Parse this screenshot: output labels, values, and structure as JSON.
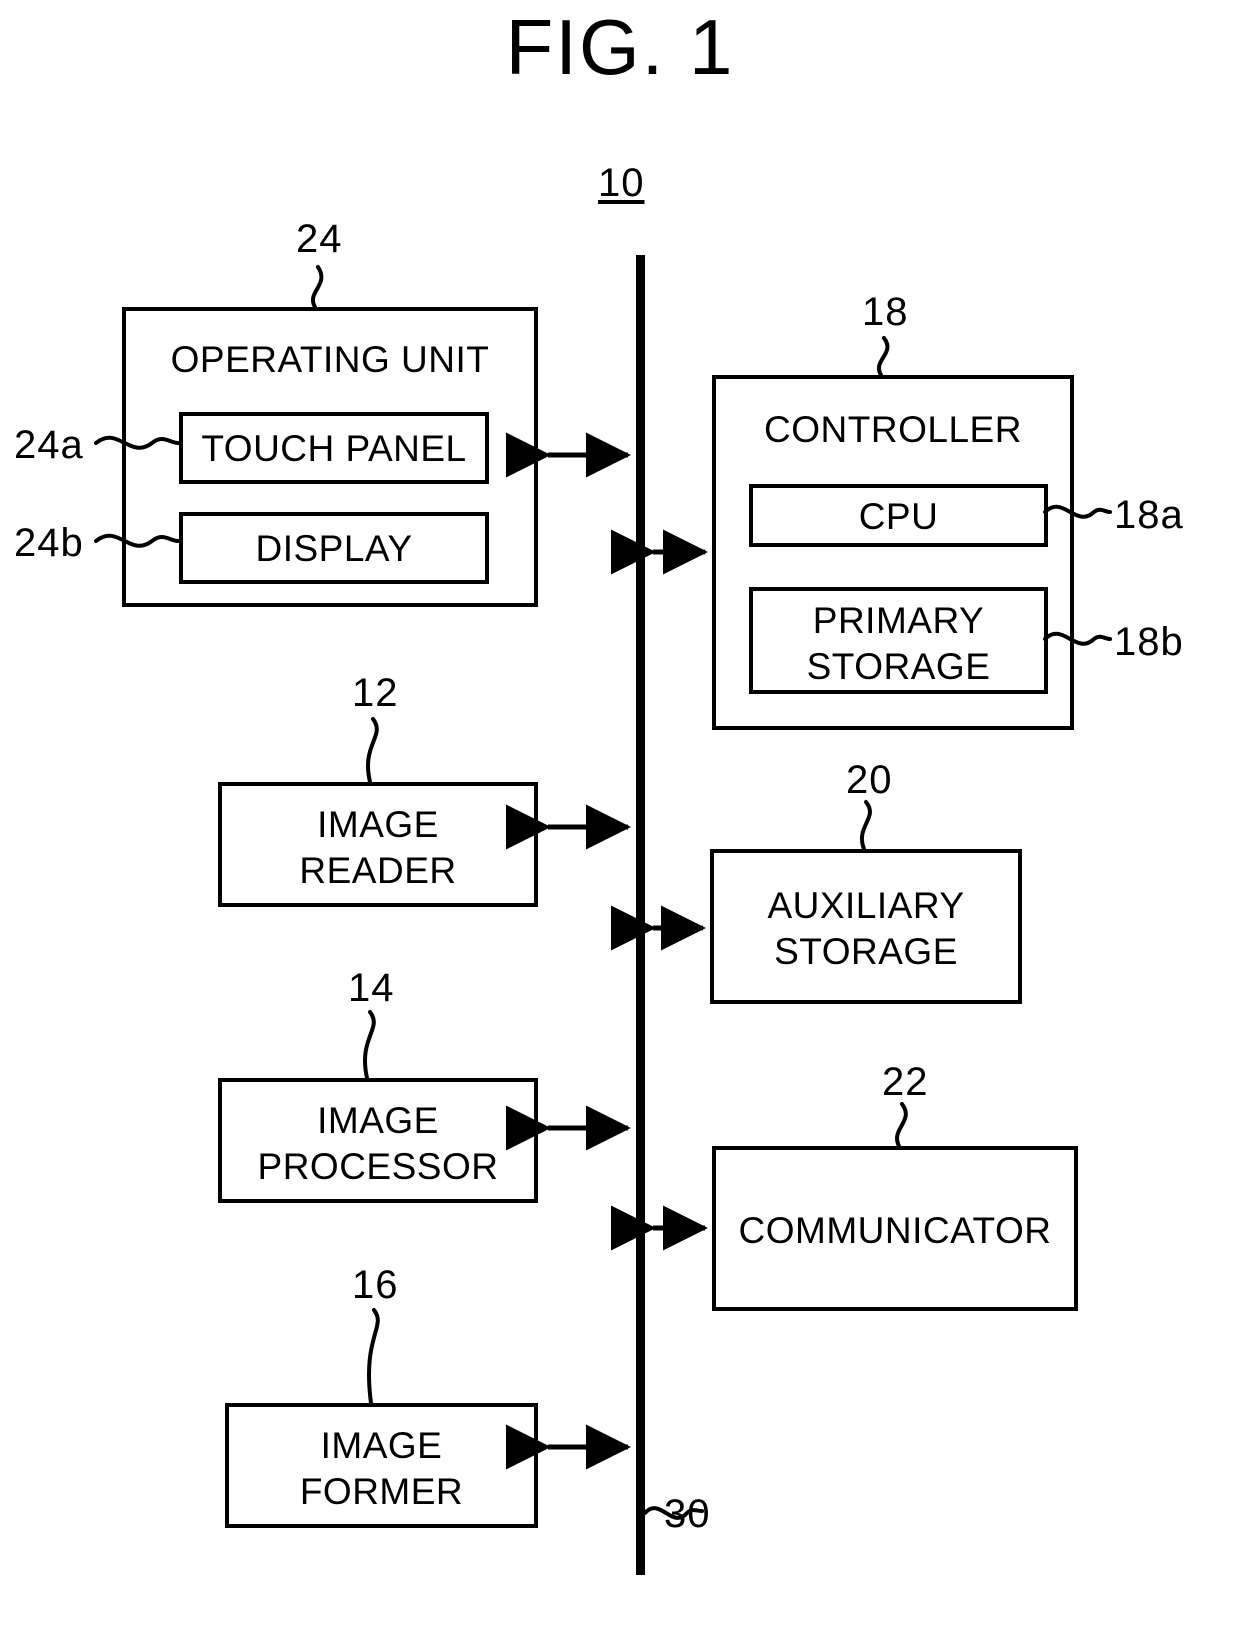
{
  "figure": {
    "title": "FIG. 1",
    "system_numeral": "10",
    "bus_numeral": "30"
  },
  "blocks": {
    "operating_unit": {
      "label": "OPERATING UNIT",
      "numeral": "24",
      "children": {
        "touch_panel": {
          "label": "TOUCH PANEL",
          "numeral": "24a"
        },
        "display": {
          "label": "DISPLAY",
          "numeral": "24b"
        }
      }
    },
    "image_reader": {
      "label": "IMAGE\nREADER",
      "numeral": "12"
    },
    "image_processor": {
      "label": "IMAGE\nPROCESSOR",
      "numeral": "14"
    },
    "image_former": {
      "label": "IMAGE\nFORMER",
      "numeral": "16"
    },
    "controller": {
      "label": "CONTROLLER",
      "numeral": "18",
      "children": {
        "cpu": {
          "label": "CPU",
          "numeral": "18a"
        },
        "primary_storage": {
          "label": "PRIMARY\nSTORAGE",
          "numeral": "18b"
        }
      }
    },
    "auxiliary_storage": {
      "label": "AUXILIARY\nSTORAGE",
      "numeral": "20"
    },
    "communicator": {
      "label": "COMMUNICATOR",
      "numeral": "22"
    }
  },
  "colors": {
    "ink": "#000000",
    "paper": "#ffffff"
  }
}
